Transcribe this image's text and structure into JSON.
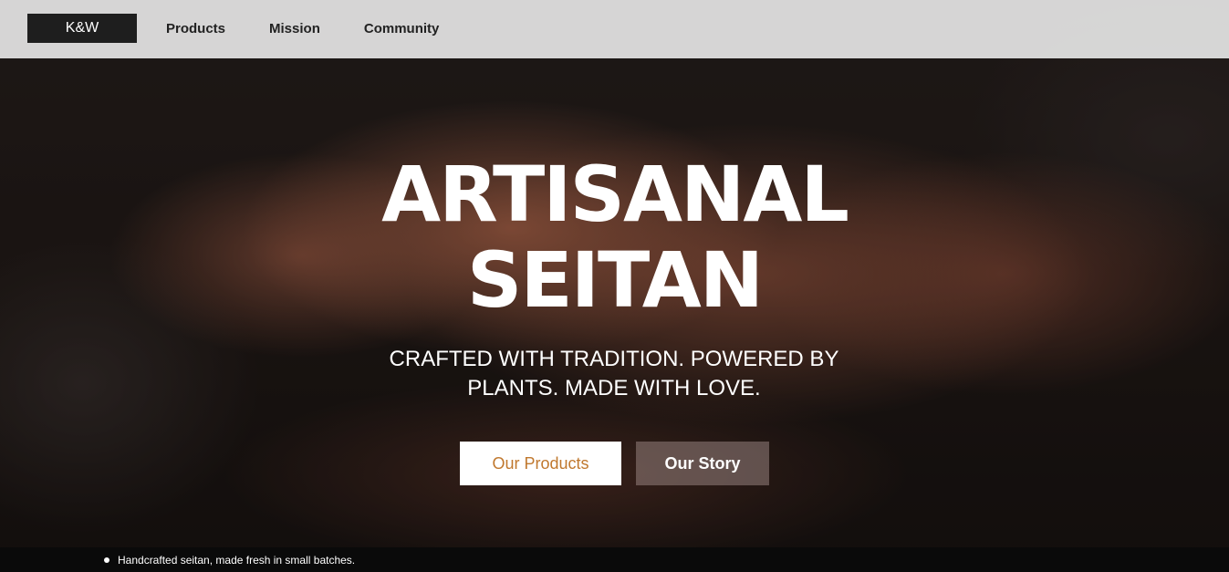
{
  "header": {
    "logo": "K&W",
    "nav": [
      {
        "label": "Products"
      },
      {
        "label": "Mission"
      },
      {
        "label": "Community"
      }
    ]
  },
  "hero": {
    "title_line1": "ARTISANAL",
    "title_line2": "SEITAN",
    "subtitle": "CRAFTED WITH TRADITION. POWERED BY PLANTS. MADE WITH LOVE.",
    "primary_button": "Our Products",
    "secondary_button": "Our Story"
  },
  "ticker": {
    "items": [
      "Handcrafted seitan, made fresh in small batches."
    ]
  },
  "colors": {
    "header_bg": "#e6e6e6",
    "logo_bg": "#1e1e1e",
    "primary_button_text": "#c0782e",
    "ticker_bg": "#0a0a0a"
  }
}
